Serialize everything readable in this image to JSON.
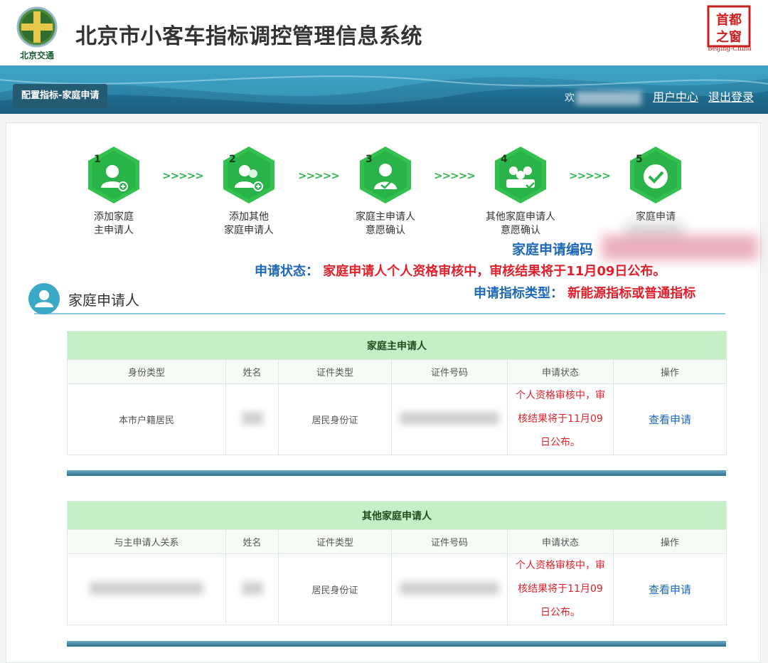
{
  "header": {
    "logo_text": "北京交通",
    "system_title": "北京市小客车指标调控管理信息系统",
    "seal_text": "首都之窗",
    "seal_sub": "Beijing-China"
  },
  "nav": {
    "tab_label": "配置指标-家庭申请",
    "welcome": "欢",
    "user_center": "用户中心",
    "logout": "退出登录"
  },
  "steps": [
    {
      "num": "1",
      "label_line1": "添加家庭",
      "label_line2": "主申请人",
      "icon": "add-user-icon"
    },
    {
      "num": "2",
      "label_line1": "添加其他",
      "label_line2": "家庭申请人",
      "icon": "add-users-icon"
    },
    {
      "num": "3",
      "label_line1": "家庭主申请人",
      "label_line2": "意愿确认",
      "icon": "user-confirm-icon"
    },
    {
      "num": "4",
      "label_line1": "其他家庭申请人",
      "label_line2": "意愿确认",
      "icon": "group-confirm-icon"
    },
    {
      "num": "5",
      "label_line1": "家庭申请",
      "label_line2": "",
      "icon": "check-circle-icon"
    }
  ],
  "step_arrow": ">>>>>",
  "application": {
    "code_label": "家庭申请编码",
    "status_label": "申请状态：",
    "status_value": "家庭申请人个人资格审核中，审核结果将于11月09日公布。",
    "type_label": "申请指标类型：",
    "type_value": "新能源指标或普通指标"
  },
  "section": {
    "title": "家庭申请人"
  },
  "main_table": {
    "caption": "家庭主申请人",
    "headers": [
      "身份类型",
      "姓名",
      "证件类型",
      "证件号码",
      "申请状态",
      "操作"
    ],
    "row": {
      "identity_type": "本市户籍居民",
      "id_type": "居民身份证",
      "status_line1": "个人资格审核中，审",
      "status_line2": "核结果将于11月09",
      "status_line3": "日公布。",
      "action": "查看申请"
    }
  },
  "other_table": {
    "caption": "其他家庭申请人",
    "headers": [
      "与主申请人关系",
      "姓名",
      "证件类型",
      "证件号码",
      "申请状态",
      "操作"
    ],
    "row": {
      "id_type": "居民身份证",
      "status_line1": "个人资格审核中，审",
      "status_line2": "核结果将于11月09",
      "status_line3": "日公布。",
      "action": "查看申请"
    }
  },
  "colors": {
    "accent_green": "#2fb44e",
    "status_red": "#e0202a",
    "label_blue": "#1d68b7",
    "banner_teal": "#1f6f93"
  }
}
